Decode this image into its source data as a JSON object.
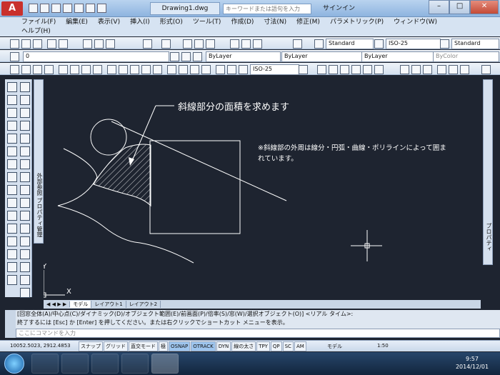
{
  "window": {
    "app_button": "A",
    "document_tab": "Drawing1.dwg",
    "search_placeholder": "キーワードまたは語句を入力",
    "signin": "サインイン"
  },
  "menu": {
    "items": [
      "ファイル(F)",
      "編集(E)",
      "表示(V)",
      "挿入(I)",
      "形式(O)",
      "ツール(T)",
      "作成(D)",
      "寸法(N)",
      "修正(M)",
      "パラメトリック(P)",
      "ウィンドウ(W)",
      "ヘルプ(H)"
    ]
  },
  "toolbars": {
    "text_style": "Standard",
    "dim_style": "ISO-25",
    "table_style": "Standard",
    "layer": "0",
    "color": "ByLayer",
    "linetype": "ByLayer",
    "lineweight": "ByLayer",
    "plotstyle": "ByColor",
    "dim_style2": "ISO-25"
  },
  "palettes": {
    "left_label": "外部参照 プロパティ管理",
    "right_label": "プロパティ"
  },
  "drawing": {
    "callout": "斜線部分の面積を求めます",
    "note_line1": "※斜線部の外周は線分・円弧・曲線・ポリラインによって囲ま",
    "note_line2": "れています。",
    "ucs_x": "X",
    "ucs_y": "Y"
  },
  "layout_tabs": [
    "モデル",
    "レイアウト1",
    "レイアウト2"
  ],
  "command": {
    "history_line1": "[回窓全体(A)/中心点(C)/ダイナミック(D)/オブジェクト範囲(E)/前画面(P)/倍率(S)/窓(W)/選択オブジェクト(O)] <リアル タイム>:",
    "history_line2": "終了するには [Esc] か [Enter] を押してください。または右クリックでショートカット メニューを表示。",
    "placeholder": "ここにコマンドを入力"
  },
  "status": {
    "coords": "10052.5023, 2912.4853",
    "toggles": [
      "スナップ",
      "グリッド",
      "直交モード",
      "極",
      "OSNAP",
      "OTRACK",
      "DYN",
      "線の太さ",
      "TPY",
      "QP",
      "SC",
      "AM"
    ],
    "active_toggles": [
      "OSNAP",
      "OTRACK"
    ],
    "model_label": "モデル",
    "scale": "1:50"
  },
  "taskbar": {
    "time": "9:57",
    "date": "2014/12/01"
  }
}
